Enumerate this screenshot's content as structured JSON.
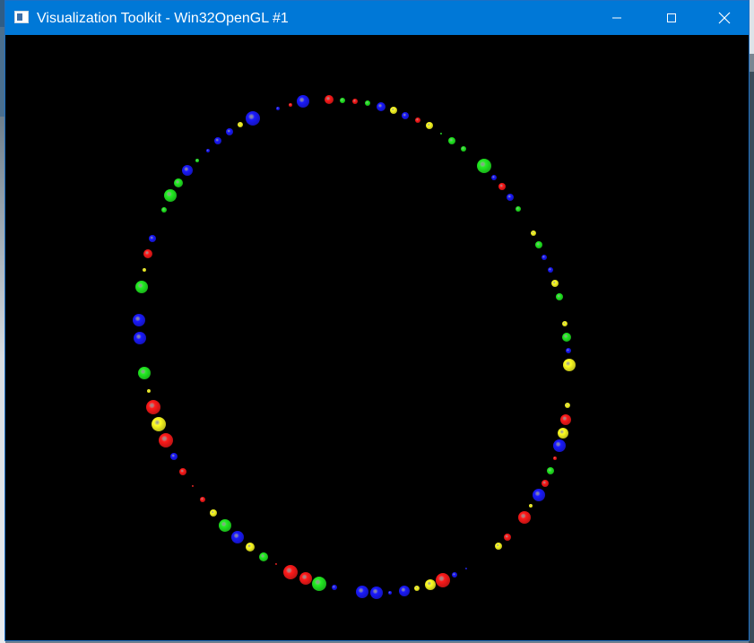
{
  "window": {
    "title": "Visualization Toolkit - Win32OpenGL #1",
    "icon": "vtk-window-icon",
    "controls": {
      "minimize": "minimize-icon",
      "maximize": "maximize-icon",
      "close": "close-icon"
    }
  },
  "colors": {
    "titlebar": "#0078d7",
    "background": "#000000",
    "red": "#ff1a1a",
    "green": "#22ee22",
    "blue": "#1a1aff",
    "yellow": "#ffff22"
  }
}
